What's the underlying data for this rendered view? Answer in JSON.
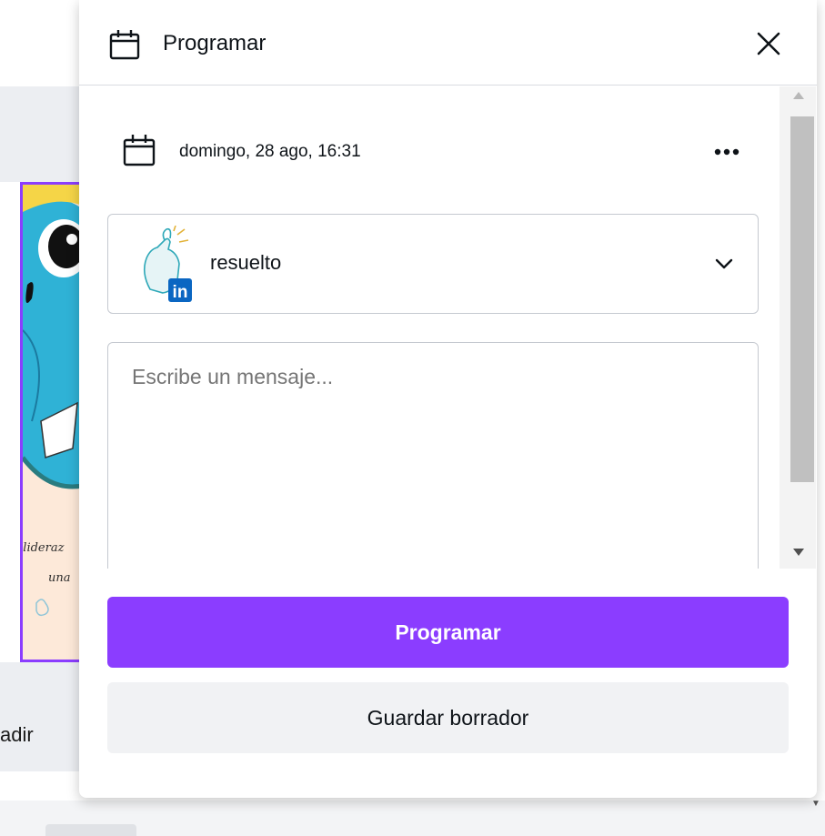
{
  "panel": {
    "title": "Programar",
    "icon": "calendar-icon",
    "close_icon": "close-icon"
  },
  "schedule": {
    "date_text": "domingo, 28 ago, 16:31",
    "icon": "calendar-icon",
    "more_icon": "more-horizontal-icon"
  },
  "account": {
    "name": "resuelto",
    "network": "LinkedIn",
    "network_badge": "in",
    "chevron_icon": "chevron-down-icon"
  },
  "message": {
    "placeholder": "Escribe un mensaje...",
    "value": ""
  },
  "actions": {
    "primary_label": "Programar",
    "secondary_label": "Guardar borrador"
  },
  "background": {
    "add_label": "adir",
    "cursive_line1": "l lideraz",
    "cursive_line2": "una"
  },
  "colors": {
    "accent": "#8b3dff",
    "linkedin": "#0a66c2",
    "secondary_bg": "#f1f2f4"
  }
}
